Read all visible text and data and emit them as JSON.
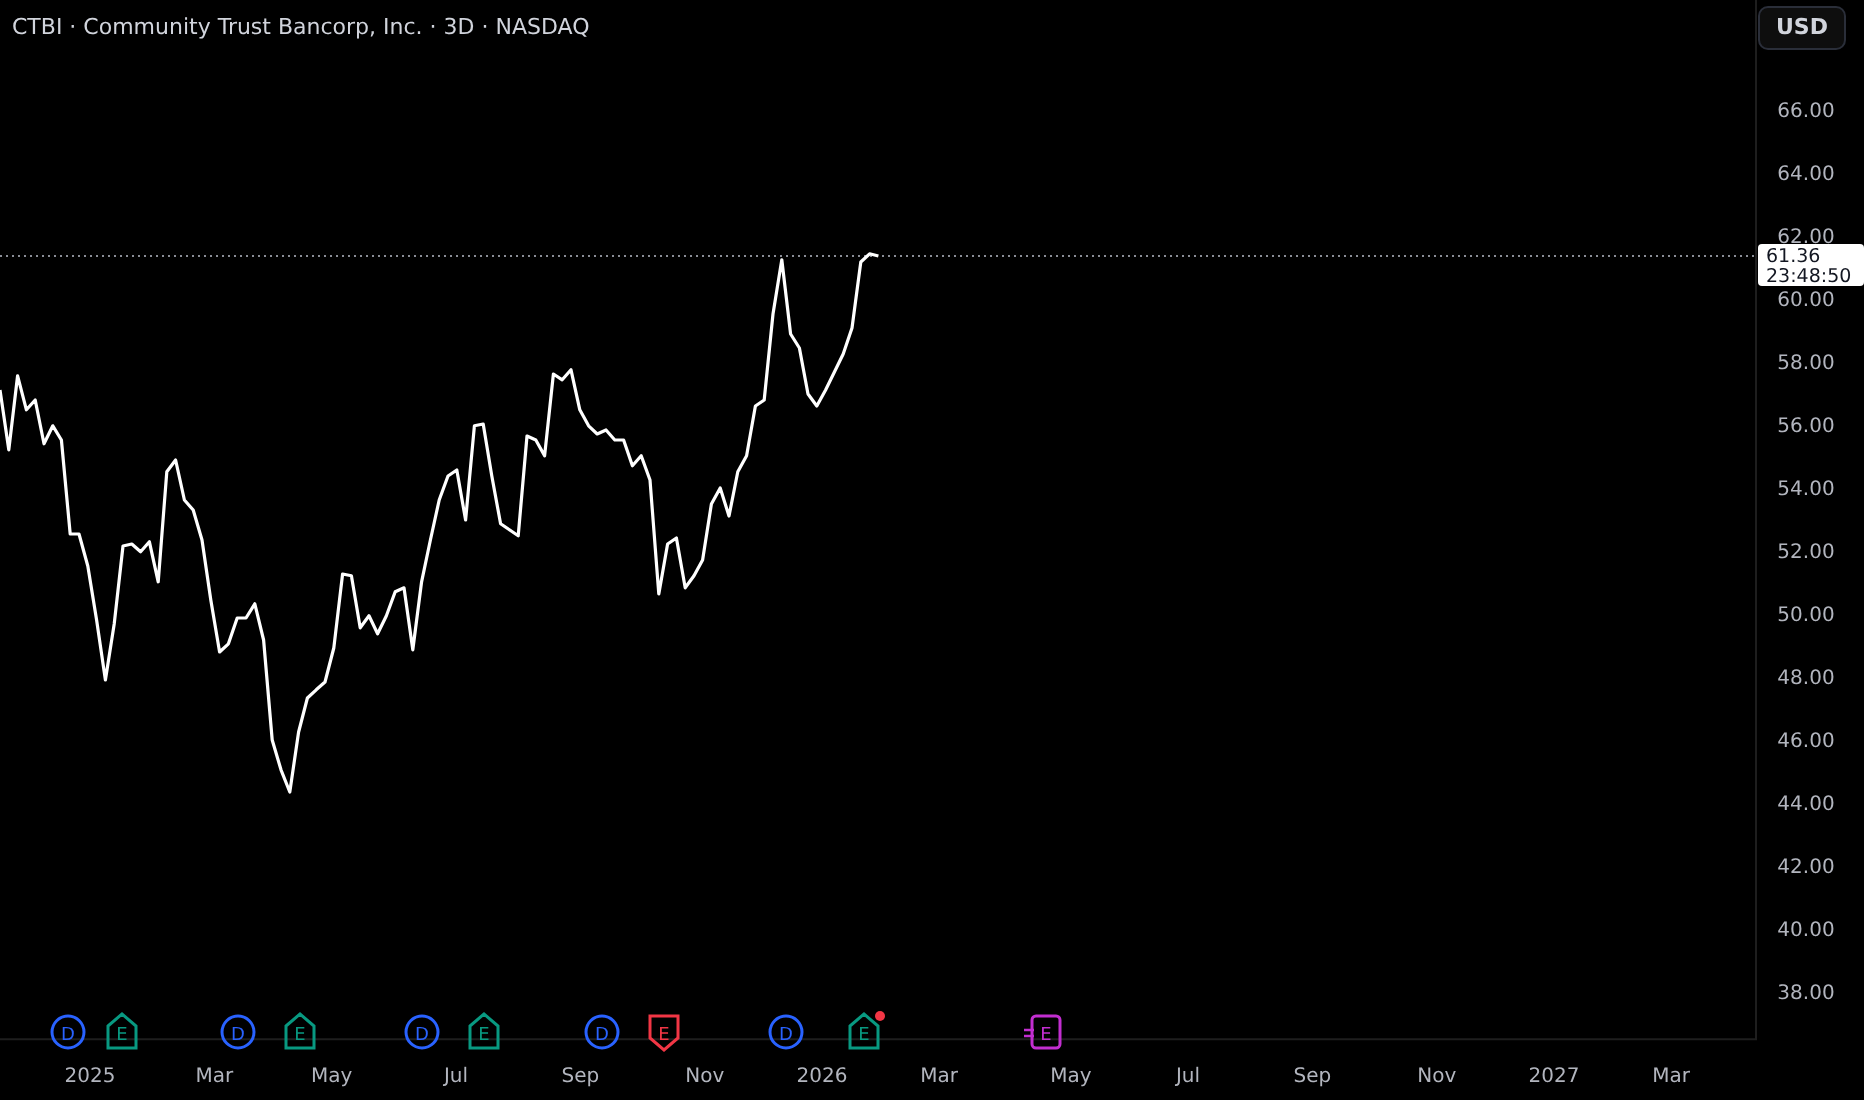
{
  "header": {
    "title": "CTBI · Community Trust Bancorp, Inc. · 3D · NASDAQ",
    "currency_button": "USD"
  },
  "price_label": {
    "countdown": "23:48:50"
  },
  "chart": {
    "chart_data": {
      "type": "line",
      "xlim": [
        2024.877,
        2027.276
      ],
      "ylim": [
        36.5,
        69.49
      ],
      "x": [
        2024.877,
        2024.889,
        2024.901,
        2024.913,
        2024.925,
        2024.937,
        2024.949,
        2024.961,
        2024.973,
        2024.985,
        2024.997,
        2025.009,
        2025.021,
        2025.033,
        2025.045,
        2025.057,
        2025.069,
        2025.081,
        2025.093,
        2025.105,
        2025.117,
        2025.129,
        2025.141,
        2025.153,
        2025.165,
        2025.177,
        2025.189,
        2025.201,
        2025.213,
        2025.225,
        2025.237,
        2025.249,
        2025.261,
        2025.273,
        2025.285,
        2025.297,
        2025.309,
        2025.321,
        2025.333,
        2025.345,
        2025.357,
        2025.369,
        2025.381,
        2025.393,
        2025.405,
        2025.417,
        2025.429,
        2025.441,
        2025.453,
        2025.465,
        2025.477,
        2025.489,
        2025.501,
        2025.513,
        2025.525,
        2025.537,
        2025.549,
        2025.561,
        2025.573,
        2025.585,
        2025.597,
        2025.609,
        2025.621,
        2025.633,
        2025.645,
        2025.657,
        2025.669,
        2025.681,
        2025.693,
        2025.705,
        2025.717,
        2025.729,
        2025.741,
        2025.753,
        2025.765,
        2025.777,
        2025.789,
        2025.801,
        2025.813,
        2025.825,
        2025.837,
        2025.849,
        2025.861,
        2025.873,
        2025.885,
        2025.897,
        2025.909,
        2025.921,
        2025.933,
        2025.945,
        2025.957,
        2025.969,
        2025.981,
        2025.993,
        2026.005,
        2026.017,
        2026.029,
        2026.041,
        2026.053,
        2026.065,
        2026.077
      ],
      "yticks": [
        {
          "value": 38,
          "label": "38.00"
        },
        {
          "value": 40,
          "label": "40.00"
        },
        {
          "value": 42,
          "label": "42.00"
        },
        {
          "value": 44,
          "label": "44.00"
        },
        {
          "value": 46,
          "label": "46.00"
        },
        {
          "value": 48,
          "label": "48.00"
        },
        {
          "value": 50,
          "label": "50.00"
        },
        {
          "value": 52,
          "label": "52.00"
        },
        {
          "value": 54,
          "label": "54.00"
        },
        {
          "value": 56,
          "label": "56.00"
        },
        {
          "value": 58,
          "label": "58.00"
        },
        {
          "value": 60,
          "label": "60.00"
        },
        {
          "value": 62,
          "label": "62.00"
        },
        {
          "value": 64,
          "label": "64.00"
        },
        {
          "value": 66,
          "label": "66.00"
        }
      ],
      "xticks": [
        {
          "value": 2025,
          "label": "2025"
        },
        {
          "value": 2025.17,
          "label": "Mar"
        },
        {
          "value": 2025.33,
          "label": "May"
        },
        {
          "value": 2025.5,
          "label": "Jul"
        },
        {
          "value": 2025.67,
          "label": "Sep"
        },
        {
          "value": 2025.84,
          "label": "Nov"
        },
        {
          "value": 2026,
          "label": "2026"
        },
        {
          "value": 2026.16,
          "label": "Mar"
        },
        {
          "value": 2026.34,
          "label": "May"
        },
        {
          "value": 2026.5,
          "label": "Jul"
        },
        {
          "value": 2026.67,
          "label": "Sep"
        },
        {
          "value": 2026.84,
          "label": "Nov"
        },
        {
          "value": 2027,
          "label": "2027"
        },
        {
          "value": 2027.16,
          "label": "Mar"
        }
      ],
      "ref_lines": [
        {
          "axis": "y",
          "value": 61.36,
          "label": "61.36",
          "color": "#8a8d96"
        }
      ],
      "series": [
        {
          "color": "#ffffff",
          "values": [
            57.11,
            55.21,
            57.56,
            56.48,
            56.79,
            55.4,
            55.97,
            55.52,
            52.54,
            52.54,
            51.52,
            49.81,
            47.9,
            49.68,
            52.16,
            52.22,
            51.97,
            52.29,
            51.02,
            54.51,
            54.89,
            53.62,
            53.3,
            52.35,
            50.44,
            48.79,
            49.05,
            49.87,
            49.87,
            50.32,
            49.17,
            46.0,
            45.05,
            44.35,
            46.25,
            47.33,
            47.59,
            47.84,
            48.92,
            51.27,
            51.21,
            49.56,
            49.94,
            49.37,
            49.94,
            50.7,
            50.83,
            48.86,
            51.02,
            52.35,
            53.62,
            54.38,
            54.57,
            52.98,
            55.97,
            56.03,
            54.38,
            52.86,
            52.67,
            52.48,
            55.65,
            55.52,
            55.02,
            57.62,
            57.43,
            57.75,
            56.48,
            55.97,
            55.71,
            55.84,
            55.52,
            55.52,
            54.7,
            55.02,
            54.25,
            50.63,
            52.22,
            52.41,
            50.83,
            51.21,
            51.71,
            53.49,
            54.0,
            53.11,
            54.51,
            55.02,
            56.6,
            56.79,
            59.52,
            61.24,
            58.89,
            58.44,
            56.98,
            56.6,
            57.11,
            57.68,
            58.25,
            59.08,
            61.17,
            61.43,
            61.36
          ]
        }
      ]
    }
  },
  "events": [
    {
      "kind": "dividend",
      "letter": "D",
      "color": "#2962ff"
    },
    {
      "kind": "earnings",
      "letter": "E",
      "color": "#089981"
    },
    {
      "kind": "dividend",
      "letter": "D",
      "color": "#2962ff"
    },
    {
      "kind": "earnings",
      "letter": "E",
      "color": "#089981"
    },
    {
      "kind": "dividend",
      "letter": "D",
      "color": "#2962ff"
    },
    {
      "kind": "earnings",
      "letter": "E",
      "color": "#089981"
    },
    {
      "kind": "dividend",
      "letter": "D",
      "color": "#2962ff"
    },
    {
      "kind": "earnings_miss",
      "letter": "E",
      "color": "#f23645"
    },
    {
      "kind": "dividend",
      "letter": "D",
      "color": "#2962ff"
    },
    {
      "kind": "earnings",
      "letter": "E",
      "color": "#089981",
      "alert": true
    },
    {
      "kind": "earnings_upcoming",
      "letter": "E",
      "color": "#c22ed0"
    }
  ]
}
